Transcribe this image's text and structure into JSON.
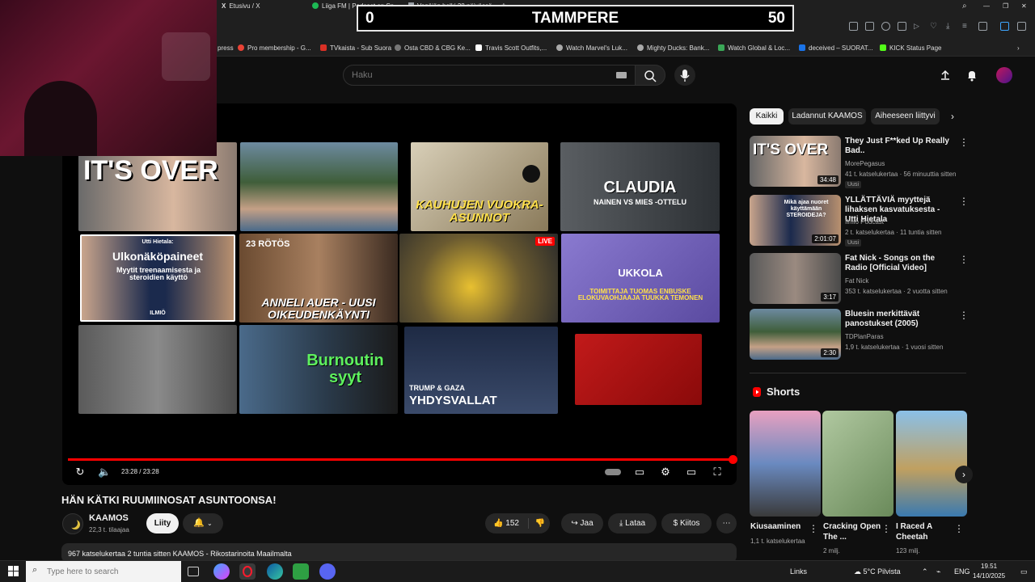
{
  "browser": {
    "tabs": [
      "Etusivu / X",
      "Liiga FM | Podcast on Sp",
      "Venäjän halki 38 päivässä"
    ],
    "bookmarks": [
      "press",
      "Pro membership - G...",
      "TVkaista - Sub Suora",
      "Osta CBD & CBG Ke...",
      "Travis Scott Outfits,...",
      "Watch Marvel's Luk...",
      "Mighty Ducks: Bank...",
      "Watch Global & Loc...",
      "deceived – SUORAT...",
      "KICK Status Page"
    ]
  },
  "scoreboard": {
    "home_score": "0",
    "team": "TAMMPERE",
    "away_score": "50"
  },
  "youtube": {
    "search_placeholder": "Haku",
    "player": {
      "endscreen": [
        {
          "text": "IT'S OVER"
        },
        {
          "text": ""
        },
        {
          "text": "KAUHUJEN VUOKRA-ASUNNOT"
        },
        {
          "text": "CLAUDIA",
          "sub": "NAINEN VS MIES -OTTELU"
        },
        {
          "text": "Ulkonäköpaineet",
          "pre": "Utti Hietala:",
          "sub": "Myytit treenaamisesta ja steroidien käyttö",
          "brand": "ILMIÖ"
        },
        {
          "text": "ANNELI AUER - UUSI OIKEUDENKÄYNTI",
          "pre": "23 RÖTÖS"
        },
        {
          "text": "",
          "badge": "LIVE"
        },
        {
          "text": "UKKOLA",
          "sub": "TOIMITTAJA TUOMAS ENBUSKE ELOKUVAOHJAAJA TUUKKA TEMONEN"
        },
        {
          "text": ""
        },
        {
          "text": "Burnoutin syyt"
        },
        {
          "text": "YHDYSVALLAT",
          "pre": "TRUMP & GAZA"
        },
        {
          "text": ""
        }
      ],
      "time": "23:28 / 23:28",
      "progress": 1.0
    },
    "video": {
      "title": "HÄN KÄTKI RUUMIINOSAT ASUNTOONSA!",
      "channel": "KAAMOS",
      "subs": "22,3 t. tilaajaa",
      "join": "Liity",
      "likes": "152",
      "share": "Jaa",
      "download": "Lataa",
      "thanks": "Kiitos",
      "description": "967 katselukertaa  2 tuntia sitten  KAAMOS - Rikostarinoita Maailmalta"
    },
    "chips": [
      "Kaikki",
      "Ladannut KAAMOS",
      "Aiheeseen liittyvi"
    ],
    "recommendations": [
      {
        "title": "They Just F**ked Up Really Bad..",
        "channel": "MorePegasus",
        "meta": "41 t. katselukertaa · 56 minuuttia sitten",
        "badge": "Uusi",
        "duration": "34:48",
        "thumb_text": "IT'S OVER"
      },
      {
        "title": "YLLÄTTÄVIÄ myyttejä lihaksen kasvatuksesta - Utti Hietala",
        "channel": "Ilmiö Podcast",
        "meta": "2 t. katselukertaa · 11 tuntia sitten",
        "badge": "Uusi",
        "duration": "2:01:07",
        "thumb_text": "Mikä ajaa nuoret käyttämään STEROIDEJA?"
      },
      {
        "title": "Fat Nick - Songs on the Radio [Official Video]",
        "channel": "Fat Nick",
        "meta": "353 t. katselukertaa · 2 vuotta sitten",
        "badge": "",
        "duration": "3:17",
        "thumb_text": ""
      },
      {
        "title": "Bluesin merkittävät panostukset (2005)",
        "channel": "TDPlanParas",
        "meta": "1,9 t. katselukertaa · 1 vuosi sitten",
        "badge": "",
        "duration": "2:30",
        "thumb_text": ""
      }
    ],
    "shorts_heading": "Shorts",
    "shorts": [
      {
        "title": "Kiusaaminen",
        "meta": "1,1 t. katselukertaa"
      },
      {
        "title": "Cracking Open The ...",
        "meta": "2 milj."
      },
      {
        "title": "I Raced A Cheetah",
        "meta": "123 milj."
      }
    ]
  },
  "taskbar": {
    "search_placeholder": "Type here to search",
    "links": "Links",
    "weather": "5°C  Pilvista",
    "lang": "ENG",
    "time": "19.51",
    "date": "14/10/2025"
  }
}
